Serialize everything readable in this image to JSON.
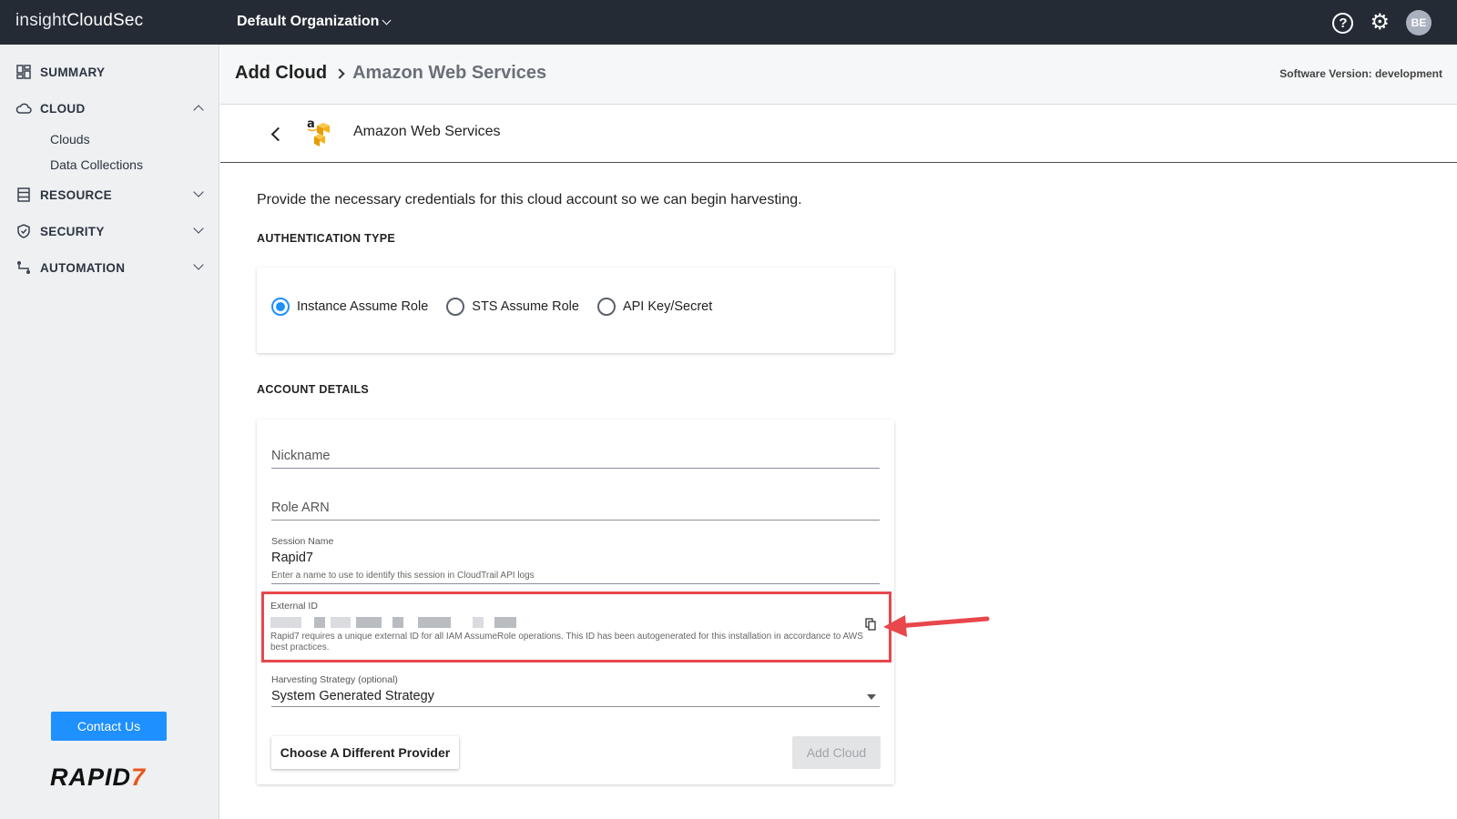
{
  "topbar": {
    "brand_light": "insight",
    "brand_bold": "CloudSec",
    "org": "Default Organization",
    "avatar": "BE",
    "icons": [
      "help-icon",
      "gear-icon"
    ]
  },
  "sidebar": {
    "items": [
      {
        "label": "SUMMARY",
        "icon": "dashboard-icon"
      },
      {
        "label": "CLOUD",
        "icon": "cloud-icon"
      },
      {
        "label": "RESOURCE",
        "icon": "resource-icon"
      },
      {
        "label": "SECURITY",
        "icon": "shield-icon"
      },
      {
        "label": "AUTOMATION",
        "icon": "automation-icon"
      }
    ],
    "cloud_sub": [
      "Clouds",
      "Data Collections"
    ],
    "contact": "Contact Us",
    "logo_main": "RAPID",
    "logo_seven": "7"
  },
  "header": {
    "crumb1": "Add Cloud",
    "crumb2": "Amazon Web Services",
    "version": "Software Version: development"
  },
  "provider": {
    "name": "Amazon Web Services"
  },
  "main": {
    "intro": "Provide the necessary credentials for this cloud account so we can begin harvesting.",
    "auth_label": "AUTHENTICATION TYPE",
    "auth_options": [
      "Instance Assume Role",
      "STS Assume Role",
      "API Key/Secret"
    ],
    "auth_selected": "Instance Assume Role",
    "details_label": "ACCOUNT DETAILS",
    "nickname_placeholder": "Nickname",
    "role_arn_placeholder": "Role ARN",
    "session_label": "Session Name",
    "session_value": "Rapid7",
    "session_hint": "Enter a name to use to identify this session in CloudTrail API logs",
    "external_label": "External ID",
    "external_hint": "Rapid7 requires a unique external ID for all IAM AssumeRole operations. This ID has been autogenerated for this installation in accordance to AWS best practices.",
    "strategy_label": "Harvesting Strategy (optional)",
    "strategy_value": "System Generated Strategy",
    "btn_choose": "Choose A Different Provider",
    "btn_add": "Add Cloud"
  }
}
